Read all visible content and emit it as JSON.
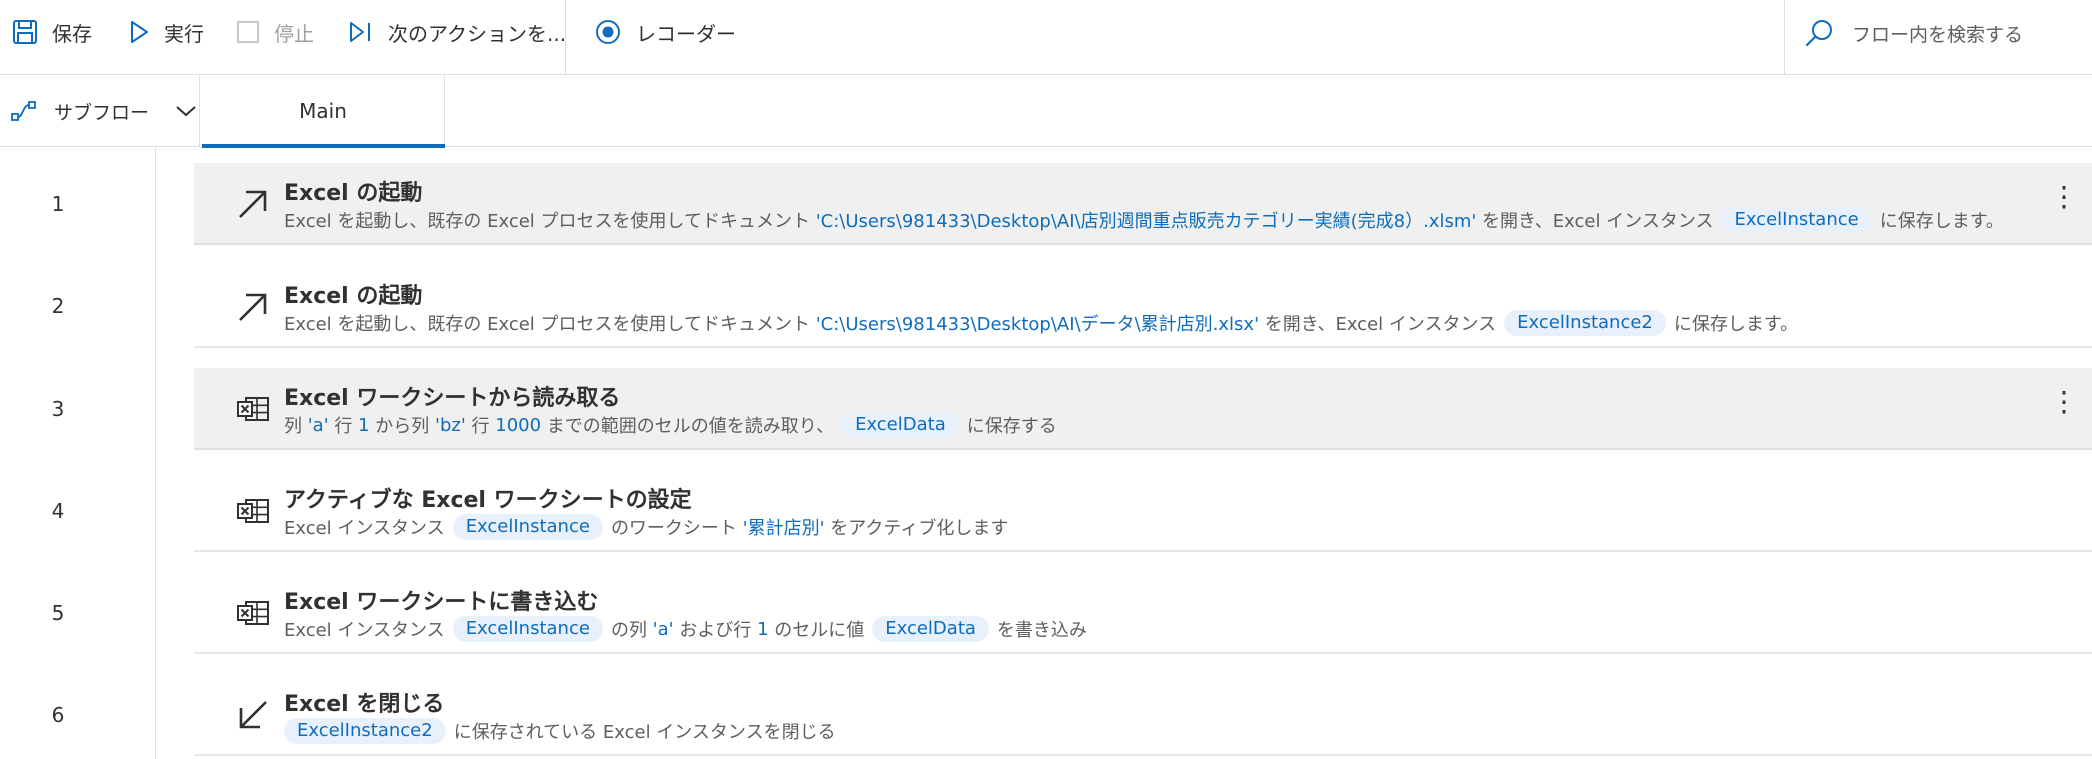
{
  "toolbar": {
    "save": "保存",
    "run": "実行",
    "stop": "停止",
    "next": "次のアクションを...",
    "recorder": "レコーダー",
    "search_placeholder": "フロー内を検索する"
  },
  "tabs": {
    "subflow": "サブフロー",
    "main": "Main"
  },
  "actions": [
    {
      "num": "1",
      "title": "Excel の起動",
      "desc": [
        "Excel を起動し、既存の Excel プロセスを使用してドキュメント ",
        "'C:\\Users\\981433\\Desktop\\AI\\店別週間重点販売カテゴリー実績(完成8）.xlsm'",
        " を開き、Excel インスタンス",
        "ExcelInstance",
        "に保存します。"
      ]
    },
    {
      "num": "2",
      "title": "Excel の起動",
      "desc": [
        "Excel を起動し、既存の Excel プロセスを使用してドキュメント ",
        "'C:\\Users\\981433\\Desktop\\AI\\データ\\累計店別.xlsx'",
        " を開き、Excel インスタンス",
        "ExcelInstance2",
        "に保存します。"
      ]
    },
    {
      "num": "3",
      "title": "Excel ワークシートから読み取る",
      "desc": [
        "列 ",
        "'a'",
        " 行 ",
        "1",
        " から列 ",
        "'bz'",
        " 行 ",
        "1000",
        " までの範囲のセルの値を読み取り、",
        "ExcelData",
        "に保存する"
      ]
    },
    {
      "num": "4",
      "title": "アクティブな Excel ワークシートの設定",
      "desc": [
        "Excel インスタンス",
        "ExcelInstance",
        "のワークシート ",
        "'累計店別'",
        " をアクティブ化します"
      ]
    },
    {
      "num": "5",
      "title": "Excel ワークシートに書き込む",
      "desc": [
        "Excel インスタンス",
        "ExcelInstance",
        "の列 ",
        "'a'",
        " および行 ",
        "1",
        " のセルに値",
        "ExcelData",
        "を書き込み"
      ]
    },
    {
      "num": "6",
      "title": "Excel を閉じる",
      "desc": [
        "ExcelInstance2",
        "に保存されている Excel インスタンスを閉じる"
      ]
    }
  ],
  "icons": {
    "launch": "arrow-up-right-icon",
    "sheet": "excel-sheet-icon",
    "close": "arrow-down-left-icon"
  },
  "colors": {
    "accent": "#0f6cbd",
    "pill_bg": "#e8f1fb",
    "selected_row": "#f0f0f0"
  }
}
